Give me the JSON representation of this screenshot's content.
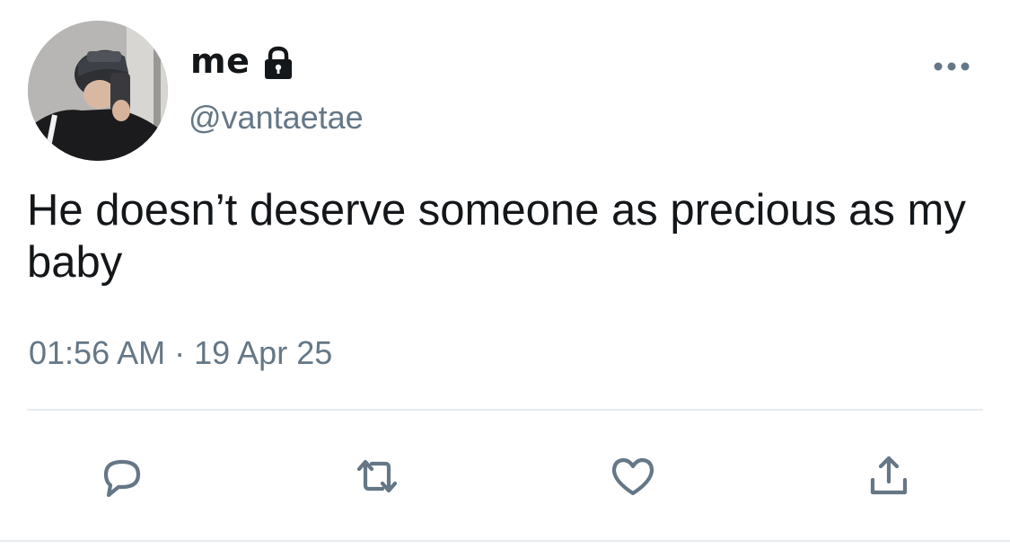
{
  "tweet": {
    "display_name": "me",
    "handle": "@vantaetae",
    "text": "He doesn’t deserve someone as precious as my baby",
    "time": "01:56 AM",
    "separator": "·",
    "date": "19 Apr 25"
  },
  "icons": {
    "lock": "lock-icon",
    "more": "more-options-icon",
    "reply": "reply-icon",
    "retweet": "retweet-icon",
    "like": "heart-icon",
    "share": "share-icon"
  },
  "colors": {
    "text": "#14171a",
    "secondary": "#657786",
    "divider": "#e6ecf0",
    "background": "#ffffff"
  }
}
